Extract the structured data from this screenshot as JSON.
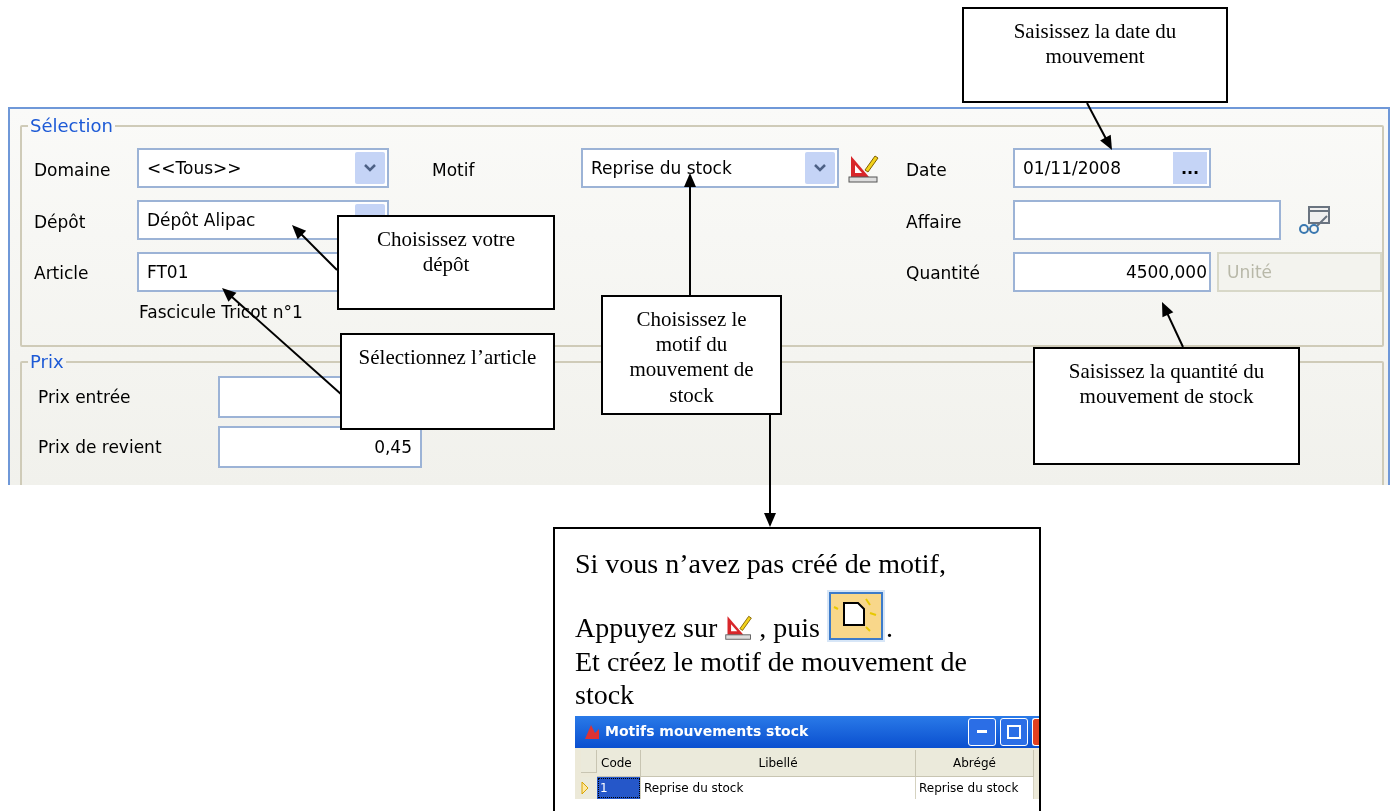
{
  "selection_group": {
    "title": "Sélection",
    "fields": [
      {
        "label": "Domaine",
        "value": "<<Tous>>",
        "kind": "combo"
      },
      {
        "label": "Dépôt",
        "value": "Dépôt Alipac",
        "kind": "combo"
      },
      {
        "label": "Article",
        "value": "FT01",
        "kind": "text"
      }
    ],
    "article_description": "Fascicule Tricot n°1",
    "motif": {
      "label": "Motif",
      "value": "Reprise du stock"
    },
    "date": {
      "label": "Date",
      "value": "01/11/2008",
      "button": "..."
    },
    "affaire": {
      "label": "Affaire"
    },
    "quantite": {
      "label": "Quantité",
      "value": "4500,000",
      "unit": {
        "value": "Unité",
        "disabled": true
      }
    }
  },
  "prix_group": {
    "title": "Prix",
    "fields": [
      {
        "label": "Prix entrée"
      },
      {
        "label": "Prix de revient",
        "value": "0,45"
      }
    ]
  },
  "callouts": [
    {
      "text": "Saisissez la date du mouvement"
    },
    {
      "text": "Choisissez votre dépôt"
    },
    {
      "text": "Sélectionnez l’article"
    },
    {
      "text": "Choisissez le motif du mouvement de stock"
    },
    {
      "text": "Saisissez la quantité du mouvement de stock"
    }
  ],
  "help_box": {
    "line_1": "Si vous n’avez pas créé de motif,",
    "line_2_start": "Appuyez sur",
    "line_2_middle": ", puis",
    "line_2_end": ".",
    "line_3": "Et créez le motif de mouvement de stock",
    "window": {
      "title": "Motifs mouvements stock",
      "columns": [
        "Code",
        "Libellé",
        "Abrégé"
      ],
      "rows": [
        {
          "cells": [
            "1",
            "Reprise du stock",
            "Reprise du stock"
          ],
          "selected": true
        }
      ]
    }
  }
}
